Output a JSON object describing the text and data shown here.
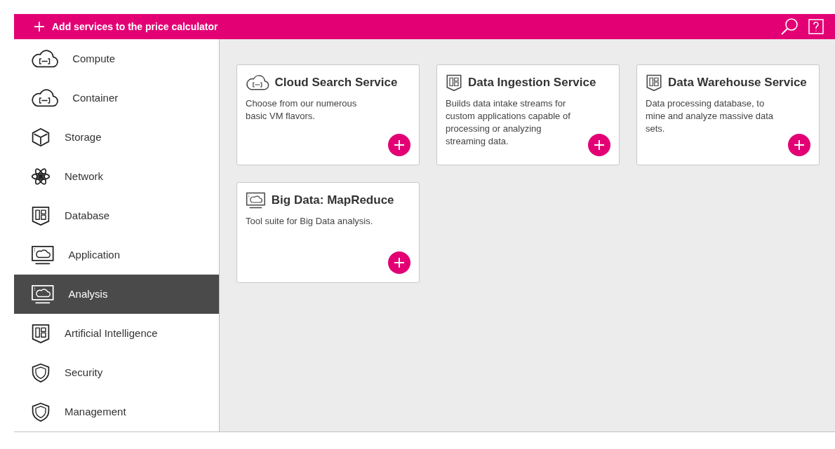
{
  "header": {
    "title": "Add services to the price calculator"
  },
  "sidebar": {
    "items": [
      {
        "label": "Compute",
        "kind": "cloud",
        "selected": false
      },
      {
        "label": "Container",
        "kind": "cloud",
        "selected": false
      },
      {
        "label": "Storage",
        "kind": "cube",
        "selected": false
      },
      {
        "label": "Network",
        "kind": "atom",
        "selected": false
      },
      {
        "label": "Database",
        "kind": "panel",
        "selected": false
      },
      {
        "label": "Application",
        "kind": "monitor",
        "selected": false
      },
      {
        "label": "Analysis",
        "kind": "monitor",
        "selected": true
      },
      {
        "label": "Artificial Intelligence",
        "kind": "panel",
        "selected": false
      },
      {
        "label": "Security",
        "kind": "shield",
        "selected": false
      },
      {
        "label": "Management",
        "kind": "shield",
        "selected": false
      }
    ]
  },
  "cards": [
    {
      "title": "Cloud Search Service",
      "kind": "cloud",
      "description": "Choose from our numerous basic VM flavors."
    },
    {
      "title": "Data Ingestion Service",
      "kind": "panel",
      "description": "Builds data intake streams for custom applications capable of processing or analyzing streaming data."
    },
    {
      "title": "Data Warehouse Service",
      "kind": "panel",
      "description": "Data processing database, to mine and analyze massive data sets."
    },
    {
      "title": "Big Data: MapReduce",
      "kind": "monitor",
      "description": "Tool suite for Big Data analysis."
    }
  ]
}
